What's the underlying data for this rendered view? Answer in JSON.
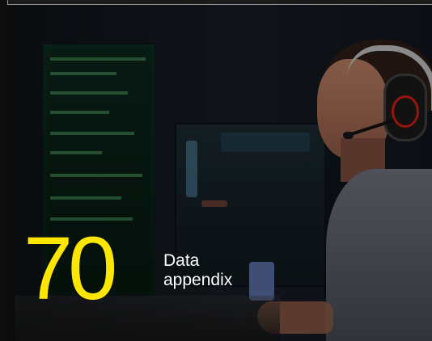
{
  "hero": {
    "number": "70",
    "title_line_1": "Data",
    "title_line_2": "appendix"
  }
}
